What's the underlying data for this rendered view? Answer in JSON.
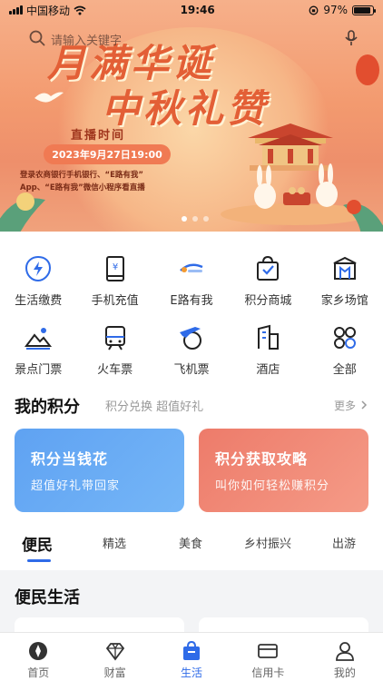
{
  "status_bar": {
    "carrier": "中国移动",
    "time": "19:46",
    "battery": "97%"
  },
  "search": {
    "placeholder": "请输入关键字"
  },
  "banner": {
    "title_line1": "月满华诞",
    "title_line2": "中秋礼赞",
    "live_label": "直播时间",
    "live_time": "2023年9月27日19:00",
    "promo_line1": "登录农商银行手机银行、“E路有我”",
    "promo_line2": "App、“E路有我”微信小程序看直播",
    "slide_count": 3,
    "active_slide": 1
  },
  "services": [
    {
      "label": "生活缴费",
      "icon": "lightning-bolt-icon"
    },
    {
      "label": "手机充值",
      "icon": "phone-yuan-icon"
    },
    {
      "label": "E路有我",
      "icon": "e-road-logo-icon"
    },
    {
      "label": "积分商城",
      "icon": "shopping-bag-icon"
    },
    {
      "label": "家乡场馆",
      "icon": "building-hall-icon"
    },
    {
      "label": "景点门票",
      "icon": "mountain-ticket-icon"
    },
    {
      "label": "火车票",
      "icon": "train-icon"
    },
    {
      "label": "飞机票",
      "icon": "airplane-globe-icon"
    },
    {
      "label": "酒店",
      "icon": "hotel-icon"
    },
    {
      "label": "全部",
      "icon": "grid-all-icon"
    }
  ],
  "points": {
    "title": "我的积分",
    "subtitle": "积分兑换 超值好礼",
    "more_label": "更多",
    "cards": [
      {
        "title": "积分当钱花",
        "subtitle": "超值好礼带回家",
        "color": "#5fa2f2"
      },
      {
        "title": "积分获取攻略",
        "subtitle": "叫你如何轻松赚积分",
        "color": "#ed7b6a"
      }
    ]
  },
  "tabs": [
    "便民",
    "精选",
    "美食",
    "乡村振兴",
    "出游"
  ],
  "active_tab": "便民",
  "section": {
    "title": "便民生活"
  },
  "bottom_nav": [
    {
      "label": "首页",
      "icon": "home-icon"
    },
    {
      "label": "财富",
      "icon": "diamond-icon"
    },
    {
      "label": "生活",
      "icon": "shopping-bag-icon"
    },
    {
      "label": "信用卡",
      "icon": "credit-card-icon"
    },
    {
      "label": "我的",
      "icon": "user-icon"
    }
  ],
  "active_nav": "生活",
  "colors": {
    "accent": "#2f6be8",
    "banner_title": "#e35f36"
  }
}
